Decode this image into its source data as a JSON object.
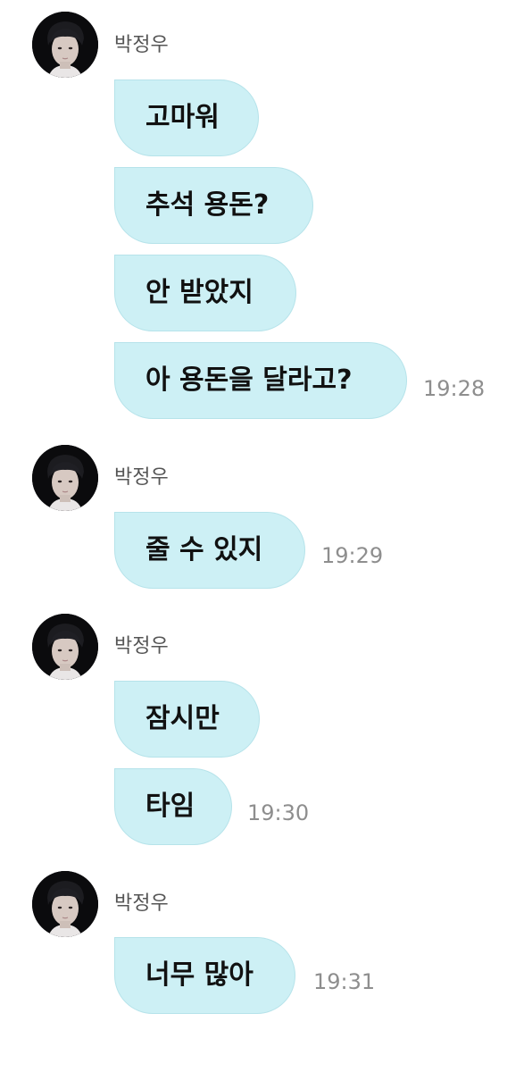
{
  "groups": [
    {
      "sender": "박정우",
      "messages": [
        "고마워",
        "추석 용돈?",
        "안 받았지",
        "아 용돈을 달라고?"
      ],
      "time": "19:28"
    },
    {
      "sender": "박정우",
      "messages": [
        "줄 수 있지"
      ],
      "time": "19:29"
    },
    {
      "sender": "박정우",
      "messages": [
        "잠시만",
        "타임"
      ],
      "time": "19:30"
    },
    {
      "sender": "박정우",
      "messages": [
        "너무 많아"
      ],
      "time": "19:31"
    }
  ],
  "colors": {
    "bubble": "#cdf0f5",
    "bubble_border": "#b6e3ea",
    "timestamp": "#8e8e8e",
    "sender_name": "#555555"
  },
  "icons": {
    "avatar": "profile-photo"
  }
}
